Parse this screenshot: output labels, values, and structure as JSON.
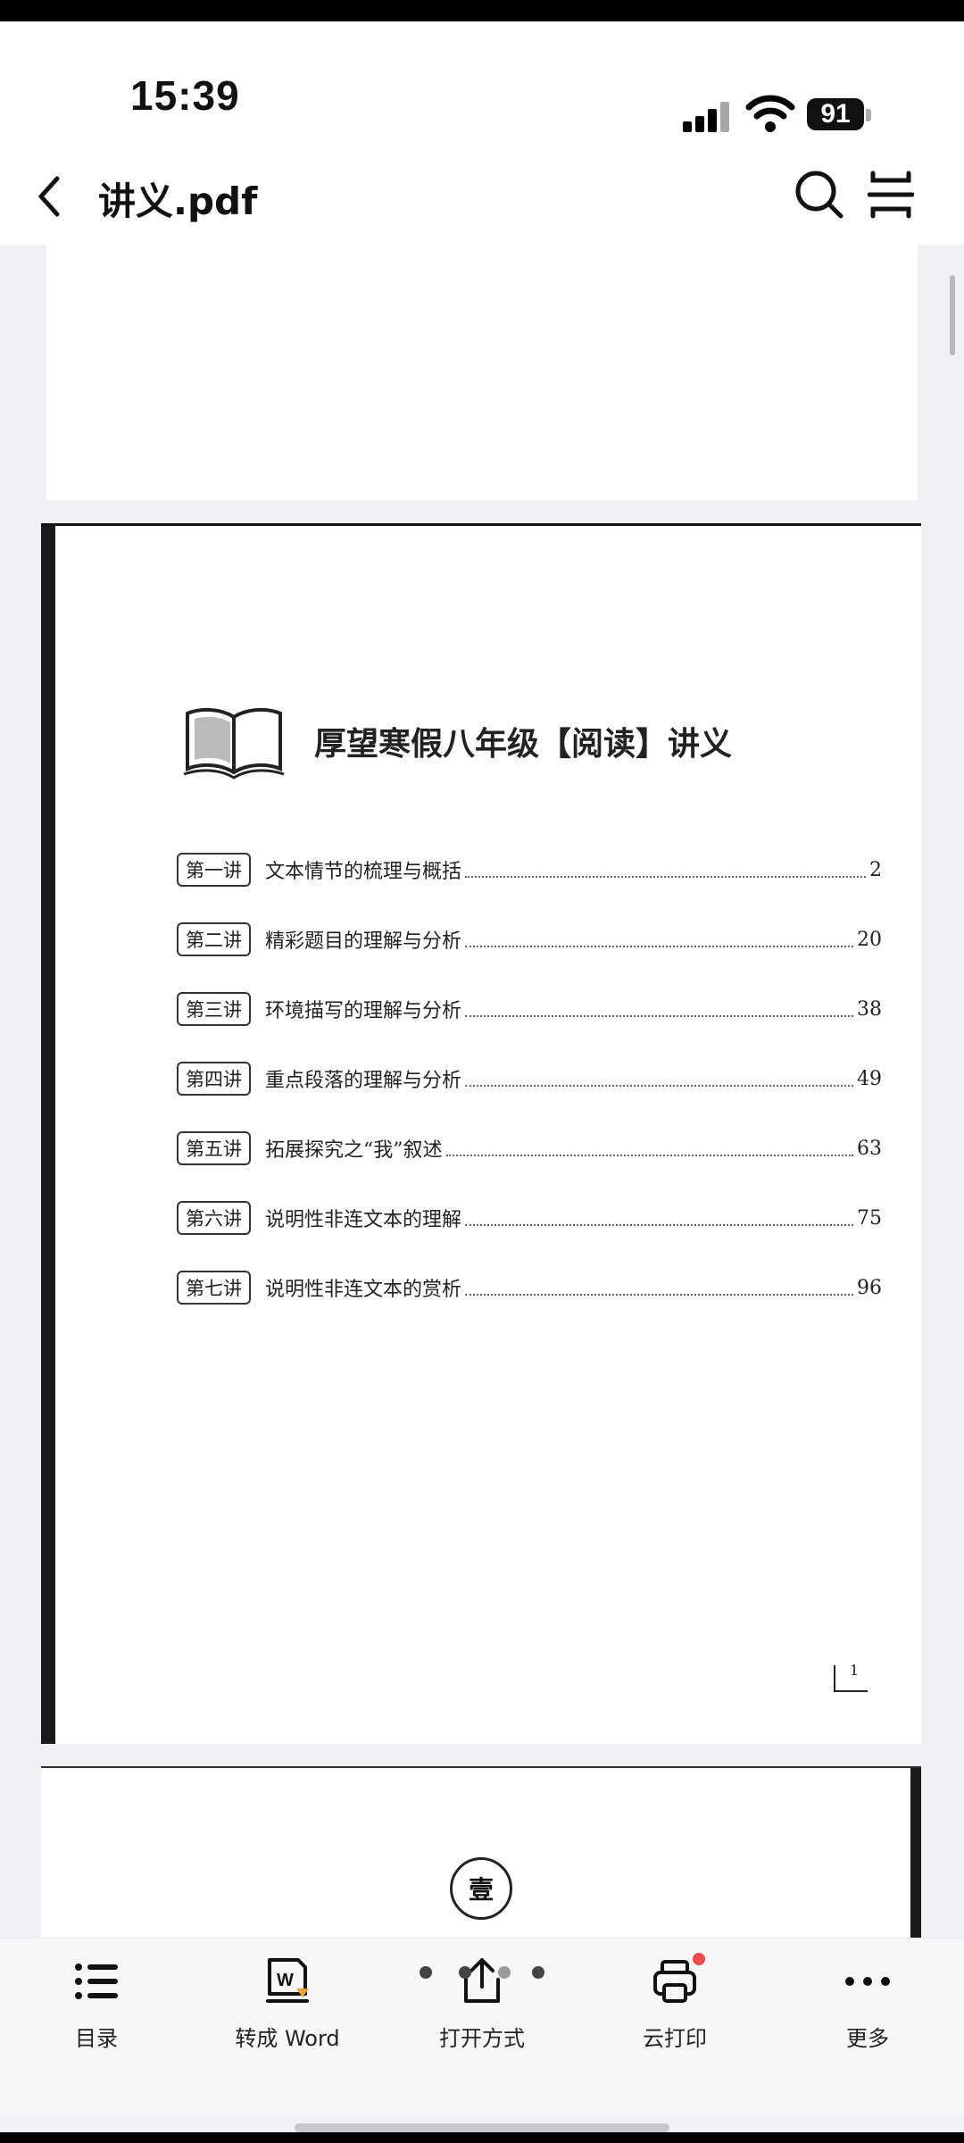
{
  "status": {
    "time": "15:39",
    "battery": "91"
  },
  "nav": {
    "title": "讲义.pdf"
  },
  "document": {
    "title": "厚望寒假八年级【阅读】讲义",
    "toc": [
      {
        "badge": "第一讲",
        "title": "文本情节的梳理与概括",
        "page": "2"
      },
      {
        "badge": "第二讲",
        "title": "精彩题目的理解与分析",
        "page": "20"
      },
      {
        "badge": "第三讲",
        "title": "环境描写的理解与分析",
        "page": "38"
      },
      {
        "badge": "第四讲",
        "title": "重点段落的理解与分析",
        "page": "49"
      },
      {
        "badge": "第五讲",
        "title": "拓展探究之“我”叙述",
        "page": "63"
      },
      {
        "badge": "第六讲",
        "title": "说明性非连文本的理解",
        "page": "75"
      },
      {
        "badge": "第七讲",
        "title": "说明性非连文本的赏析",
        "page": "96"
      }
    ],
    "page_number": "1",
    "seal_char": "壹"
  },
  "toolbar": [
    {
      "label": "目录",
      "icon": "list-icon"
    },
    {
      "label": "转成 Word",
      "icon": "word-convert-icon"
    },
    {
      "label": "打开方式",
      "icon": "share-icon"
    },
    {
      "label": "云打印",
      "icon": "printer-icon"
    },
    {
      "label": "更多",
      "icon": "more-icon"
    }
  ]
}
